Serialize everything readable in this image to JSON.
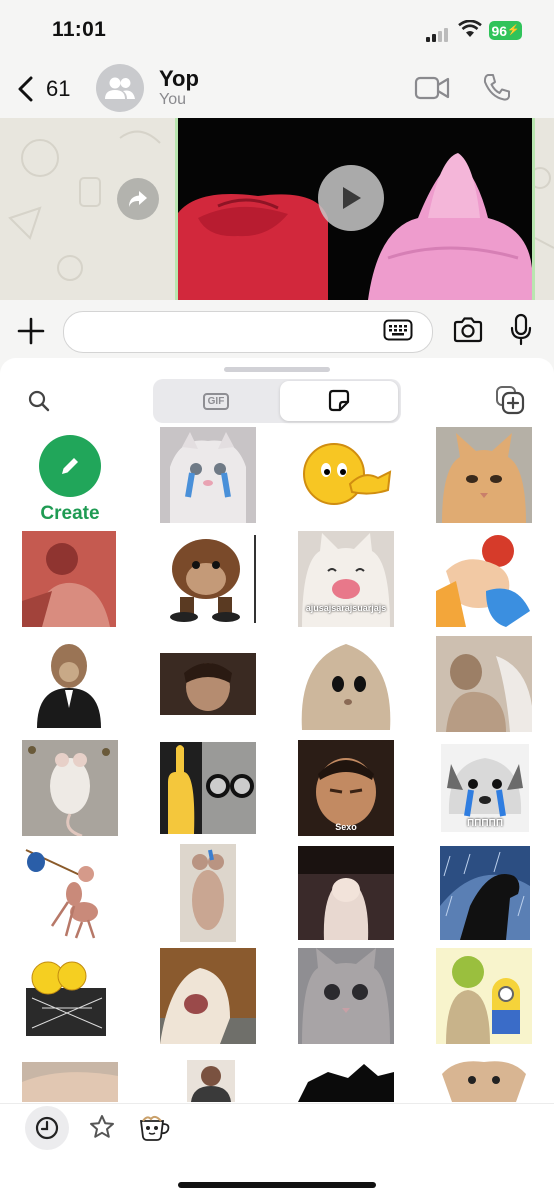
{
  "status": {
    "time": "11:01",
    "battery": "96"
  },
  "header": {
    "back_count": "61",
    "contact_name": "Yop",
    "contact_subtitle": "You"
  },
  "composer": {
    "placeholder": ""
  },
  "panel": {
    "tabs": [
      {
        "label": "GIF",
        "selected": false
      },
      {
        "label": "sticker",
        "selected": true
      }
    ],
    "create_label": "Create",
    "sticker_captions": {
      "cat_pink_nose": "ajusajsarajsuarjajs",
      "kid_glare": "Sexo",
      "crying_dog": "ΠΠΠΠΠ"
    }
  },
  "colors": {
    "accent_green": "#21a65a",
    "battery_green": "#30c35a",
    "chat_wallpaper": "#e8e6de"
  },
  "icons": [
    "chevron-left-icon",
    "group-avatar-icon",
    "video-call-icon",
    "phone-icon",
    "forward-icon",
    "play-icon",
    "plus-icon",
    "keyboard-icon",
    "camera-icon",
    "mic-icon",
    "search-icon",
    "gif-icon",
    "sticker-icon",
    "add-sticker-pack-icon",
    "pencil-icon",
    "recent-icon",
    "star-icon",
    "cup-pack-icon"
  ]
}
